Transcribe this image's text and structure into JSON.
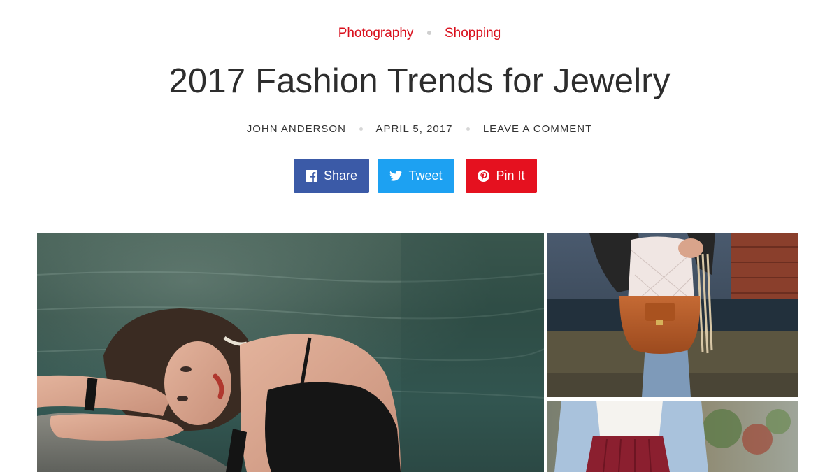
{
  "categories": [
    {
      "label": "Photography"
    },
    {
      "label": "Shopping"
    }
  ],
  "post": {
    "title": "2017 Fashion Trends for Jewelry",
    "author": "JOHN ANDERSON",
    "date": "APRIL 5, 2017",
    "comment_link": "LEAVE A COMMENT"
  },
  "share": {
    "facebook": {
      "label": "Share",
      "icon": "facebook-icon",
      "color": "#3b5aa7"
    },
    "twitter": {
      "label": "Tweet",
      "icon": "twitter-icon",
      "color": "#1da1f2"
    },
    "pinterest": {
      "label": "Pin It",
      "icon": "pinterest-icon",
      "color": "#e5111f"
    }
  },
  "colors": {
    "accent": "#d90f1c",
    "text": "#2d2d2d",
    "divider": "#e6e6e6"
  }
}
